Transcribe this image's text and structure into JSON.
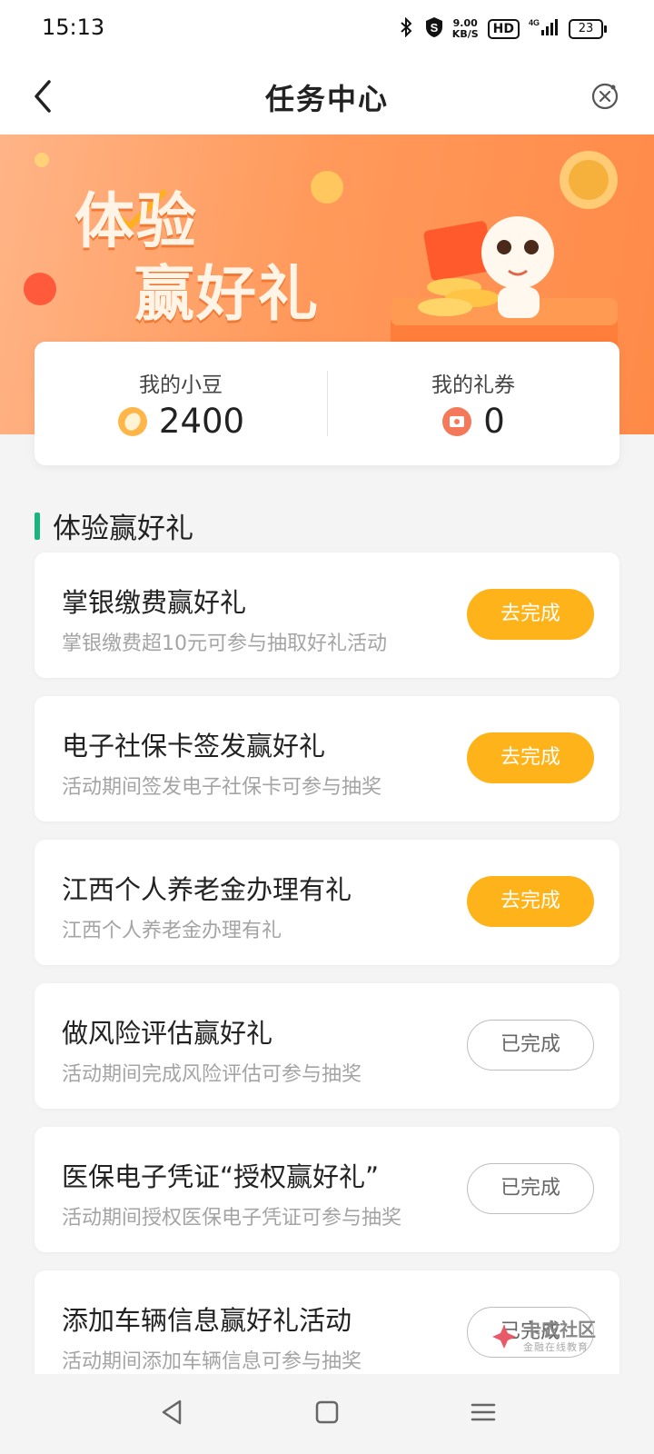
{
  "status_bar": {
    "time": "15:13",
    "net_speed": "9.00",
    "net_unit": "KB/S",
    "hd": "HD",
    "signal": "4G",
    "battery": "23"
  },
  "header": {
    "title": "任务中心"
  },
  "banner": {
    "line1": "体验",
    "line2": "赢好礼"
  },
  "stats": {
    "beans_label": "我的小豆",
    "beans_value": "2400",
    "coupons_label": "我的礼券",
    "coupons_value": "0"
  },
  "section": {
    "title": "体验赢好礼"
  },
  "tasks": [
    {
      "title": "掌银缴费赢好礼",
      "desc": "掌银缴费超10元可参与抽取好礼活动",
      "button": "去完成",
      "status": "todo"
    },
    {
      "title": "电子社保卡签发赢好礼",
      "desc": "活动期间签发电子社保卡可参与抽奖",
      "button": "去完成",
      "status": "todo"
    },
    {
      "title": "江西个人养老金办理有礼",
      "desc": "江西个人养老金办理有礼",
      "button": "去完成",
      "status": "todo"
    },
    {
      "title": "做风险评估赢好礼",
      "desc": "活动期间完成风险评估可参与抽奖",
      "button": "已完成",
      "status": "done"
    },
    {
      "title": "医保电子凭证“授权赢好礼”",
      "desc": "活动期间授权医保电子凭证可参与抽奖",
      "button": "已完成",
      "status": "done"
    },
    {
      "title": "添加车辆信息赢好礼活动",
      "desc": "活动期间添加车辆信息可参与抽奖",
      "button": "已完成",
      "status": "done"
    }
  ],
  "watermark": {
    "name": "卡农社区",
    "slogan": "金融在线教育"
  },
  "colors": {
    "accent_green": "#1bb37f",
    "button_orange": "#ffb31a",
    "banner_orange": "#ff9a5c"
  },
  "icons": {
    "back": "chevron-left-icon",
    "close": "close-circle-icon",
    "bean": "bean-coin-icon",
    "coupon": "coupon-icon"
  }
}
